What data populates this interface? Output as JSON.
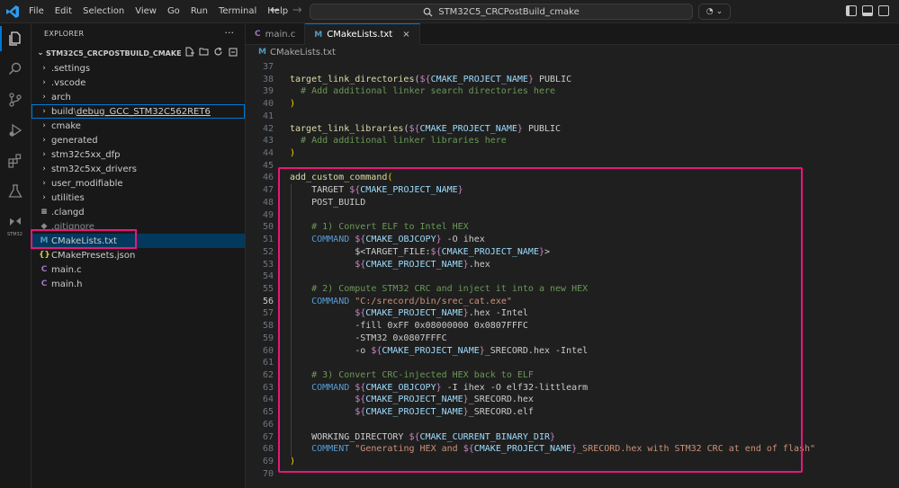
{
  "menu": [
    "File",
    "Edit",
    "Selection",
    "View",
    "Go",
    "Run",
    "Terminal",
    "Help"
  ],
  "search": {
    "text": "STM32C5_CRCPostBuild_cmake"
  },
  "sidebar": {
    "title": "EXPLORER",
    "more": "···",
    "project": "STM32C5_CRCPOSTBUILD_CMAKE",
    "items": [
      {
        "kind": "folder",
        "label": ".settings"
      },
      {
        "kind": "folder",
        "label": ".vscode"
      },
      {
        "kind": "folder",
        "label": "arch"
      },
      {
        "kind": "folder",
        "label": "build",
        "sub": "debug_GCC_STM32C562RET6"
      },
      {
        "kind": "folder",
        "label": "cmake"
      },
      {
        "kind": "folder",
        "label": "generated"
      },
      {
        "kind": "folder",
        "label": "stm32c5xx_dfp"
      },
      {
        "kind": "folder",
        "label": "stm32c5xx_drivers"
      },
      {
        "kind": "folder",
        "label": "user_modifiable"
      },
      {
        "kind": "folder",
        "label": "utilities"
      },
      {
        "kind": "file",
        "icon": "≡",
        "label": ".clangd"
      },
      {
        "kind": "file",
        "icon": "◆",
        "label": ".gitignore"
      },
      {
        "kind": "file",
        "icon": "M",
        "label": "CMakeLists.txt"
      },
      {
        "kind": "file",
        "icon": "{}",
        "label": "CMakePresets.json"
      },
      {
        "kind": "file",
        "icon": "C",
        "label": "main.c"
      },
      {
        "kind": "file",
        "icon": "C",
        "label": "main.h"
      }
    ]
  },
  "tabs": [
    {
      "icon": "C",
      "label": "main.c"
    },
    {
      "icon": "M",
      "label": "CMakeLists.txt",
      "close": "×"
    }
  ],
  "breadcrumb": {
    "icon": "M",
    "label": "CMakeLists.txt"
  },
  "activity_label": "STM32",
  "code": {
    "current_line": 56,
    "lines": [
      {
        "n": 37,
        "t": ""
      },
      {
        "n": 38,
        "t": "target_link_directories(${CMAKE_PROJECT_NAME} PUBLIC"
      },
      {
        "n": 39,
        "t": "  # Add additional linker search directories here"
      },
      {
        "n": 40,
        "t": ")"
      },
      {
        "n": 41,
        "t": ""
      },
      {
        "n": 42,
        "t": "target_link_libraries(${CMAKE_PROJECT_NAME} PUBLIC"
      },
      {
        "n": 43,
        "t": "  # Add additional linker libraries here"
      },
      {
        "n": 44,
        "t": ")"
      },
      {
        "n": 45,
        "t": ""
      },
      {
        "n": 46,
        "t": "add_custom_command("
      },
      {
        "n": 47,
        "t": "    TARGET ${CMAKE_PROJECT_NAME}"
      },
      {
        "n": 48,
        "t": "    POST_BUILD"
      },
      {
        "n": 49,
        "t": ""
      },
      {
        "n": 50,
        "t": "    # 1) Convert ELF to Intel HEX"
      },
      {
        "n": 51,
        "t": "    COMMAND ${CMAKE_OBJCOPY} -O ihex"
      },
      {
        "n": 52,
        "t": "            $<TARGET_FILE:${CMAKE_PROJECT_NAME}>"
      },
      {
        "n": 53,
        "t": "            ${CMAKE_PROJECT_NAME}.hex"
      },
      {
        "n": 54,
        "t": ""
      },
      {
        "n": 55,
        "t": "    # 2) Compute STM32 CRC and inject it into a new HEX"
      },
      {
        "n": 56,
        "t": "    COMMAND \"C:/srecord/bin/srec_cat.exe\""
      },
      {
        "n": 57,
        "t": "            ${CMAKE_PROJECT_NAME}.hex -Intel"
      },
      {
        "n": 58,
        "t": "            -fill 0xFF 0x08000000 0x0807FFFC"
      },
      {
        "n": 59,
        "t": "            -STM32 0x0807FFFC"
      },
      {
        "n": 60,
        "t": "            -o ${CMAKE_PROJECT_NAME}_SRECORD.hex -Intel"
      },
      {
        "n": 61,
        "t": ""
      },
      {
        "n": 62,
        "t": "    # 3) Convert CRC-injected HEX back to ELF"
      },
      {
        "n": 63,
        "t": "    COMMAND ${CMAKE_OBJCOPY} -I ihex -O elf32-littlearm"
      },
      {
        "n": 64,
        "t": "            ${CMAKE_PROJECT_NAME}_SRECORD.hex"
      },
      {
        "n": 65,
        "t": "            ${CMAKE_PROJECT_NAME}_SRECORD.elf"
      },
      {
        "n": 66,
        "t": ""
      },
      {
        "n": 67,
        "t": "    WORKING_DIRECTORY ${CMAKE_CURRENT_BINARY_DIR}"
      },
      {
        "n": 68,
        "t": "    COMMENT \"Generating HEX and ${CMAKE_PROJECT_NAME}_SRECORD.hex with STM32 CRC at end of flash\""
      },
      {
        "n": 69,
        "t": ")"
      },
      {
        "n": 70,
        "t": ""
      }
    ]
  },
  "colors": {
    "accent": "#0078d4",
    "annotation": "#e8177a",
    "cmake_icon": "#519aba",
    "c_icon": "#a074c4"
  }
}
